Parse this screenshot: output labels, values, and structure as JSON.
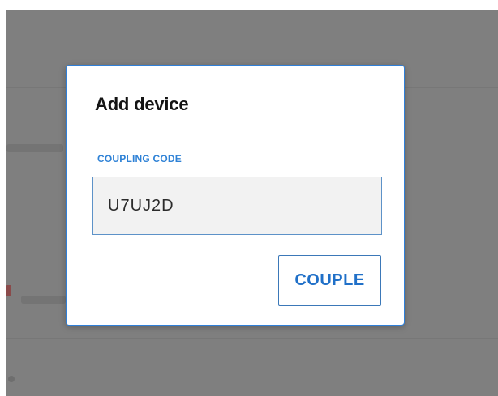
{
  "dialog": {
    "title": "Add device",
    "field_label": "COUPLING CODE",
    "code_value": "U7UJ2D",
    "couple_label": "COUPLE"
  },
  "colors": {
    "overlay": "#7f7f7f",
    "accent": "#2f82d6",
    "dialog_border": "#2f7fd8",
    "input_background": "#f2f2f2"
  }
}
